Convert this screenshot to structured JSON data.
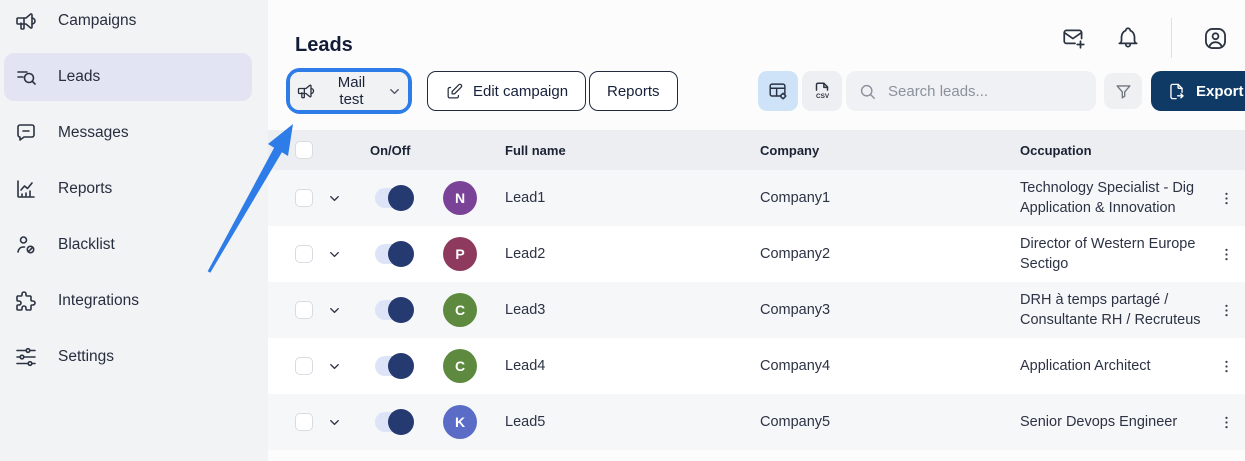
{
  "sidebar": {
    "items": [
      {
        "label": "Campaigns",
        "icon": "megaphone-icon",
        "active": false
      },
      {
        "label": "Leads",
        "icon": "lead-search-icon",
        "active": true
      },
      {
        "label": "Messages",
        "icon": "message-icon",
        "active": false
      },
      {
        "label": "Reports",
        "icon": "chart-icon",
        "active": false
      },
      {
        "label": "Blacklist",
        "icon": "user-block-icon",
        "active": false
      },
      {
        "label": "Integrations",
        "icon": "puzzle-icon",
        "active": false
      },
      {
        "label": "Settings",
        "icon": "sliders-icon",
        "active": false
      }
    ]
  },
  "header": {
    "title": "Leads",
    "icons": [
      "mail-plus-icon",
      "bell-icon",
      "account-icon"
    ]
  },
  "actions": {
    "campaign_selector_label": "Mail test",
    "edit_campaign_label": "Edit campaign",
    "reports_label": "Reports"
  },
  "toolbar": {
    "view_options": [
      "table-settings",
      "csv-export"
    ],
    "search_placeholder": "Search leads...",
    "export_label": "Export d"
  },
  "table": {
    "columns": {
      "on_off": "On/Off",
      "full_name": "Full name",
      "company": "Company",
      "occupation": "Occupation"
    },
    "rows": [
      {
        "initial": "N",
        "avatar_color": "#7b4397",
        "name": "Lead1",
        "company": "Company1",
        "occupation": "Technology Specialist - Dig Application & Innovation",
        "enabled": true
      },
      {
        "initial": "P",
        "avatar_color": "#8e3a5e",
        "name": "Lead2",
        "company": "Company2",
        "occupation": "Director of Western Europe Sectigo",
        "enabled": true
      },
      {
        "initial": "C",
        "avatar_color": "#5d8a3e",
        "name": "Lead3",
        "company": "Company3",
        "occupation": "DRH à temps partagé / Consultante RH / Recruteus",
        "enabled": true
      },
      {
        "initial": "C",
        "avatar_color": "#5d8a3e",
        "name": "Lead4",
        "company": "Company4",
        "occupation": "Application Architect",
        "enabled": true
      },
      {
        "initial": "K",
        "avatar_color": "#5a6cc5",
        "name": "Lead5",
        "company": "Company5",
        "occupation": "Senior Devops Engineer",
        "enabled": true
      }
    ]
  },
  "annotation": {
    "highlight_color": "#2e7ce8",
    "arrow_color": "#2e7ce8"
  },
  "colors": {
    "sidebar_bg": "#f2f3f5",
    "active_item_bg": "#e2e4f4",
    "table_header_bg": "#eceef2",
    "row_stripe_bg": "#f6f7f9",
    "toggle_on_knob": "#253a70",
    "toggle_track": "#dee4f7",
    "export_button_bg": "#0f3a66",
    "segment_active_bg": "#cfe3f8"
  }
}
